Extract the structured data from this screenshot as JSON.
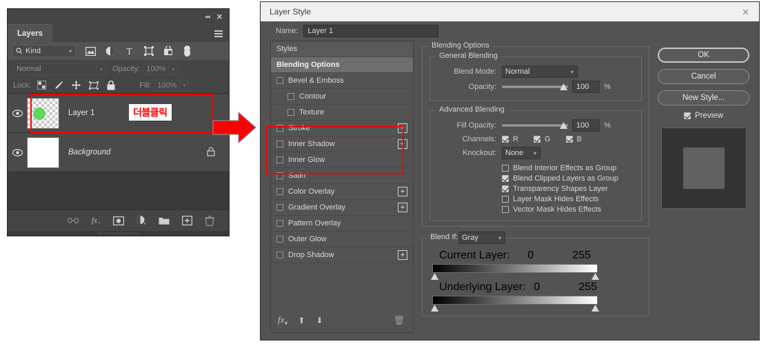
{
  "layers_panel": {
    "title": "Layers",
    "collapse_icon": "double-chevron-left-icon",
    "close_icon": "close-icon",
    "menu_icon": "panel-menu-icon",
    "filter": {
      "kind_label": "Kind",
      "search_icon": "search-icon",
      "chevron": "⌄",
      "icons": [
        "pixel-layer-filter-icon",
        "adjustment-layer-filter-icon",
        "type-layer-filter-icon",
        "shape-layer-filter-icon",
        "smart-object-filter-icon",
        "filter-toggle-icon"
      ]
    },
    "blend_mode": "Normal",
    "opacity_label": "Opacity:",
    "opacity_value": "100%",
    "lock_label": "Lock:",
    "lock_icons": [
      "lock-transparent-pixels-icon",
      "lock-image-pixels-icon",
      "lock-position-icon",
      "lock-artboard-nesting-icon",
      "lock-all-icon"
    ],
    "fill_label": "Fill:",
    "fill_value": "100%",
    "layers": [
      {
        "name": "Layer 1",
        "visible": true,
        "italic": false,
        "locked": false,
        "thumb": "transparent-green-dot",
        "annotation": "더블클릭"
      },
      {
        "name": "Background",
        "visible": true,
        "italic": true,
        "locked": true,
        "thumb": "white",
        "annotation": ""
      }
    ],
    "bottom_icons": [
      "link-layers-icon",
      "add-layer-style-icon",
      "add-layer-mask-icon",
      "new-adjustment-layer-icon",
      "new-group-icon",
      "new-layer-icon",
      "delete-layer-icon"
    ],
    "highlight_color": "#fb0000"
  },
  "arrow": {
    "name": "red-right-arrow",
    "color": "#fb0000"
  },
  "dialog": {
    "title": "Layer Style",
    "close_icon": "close-icon",
    "name_label": "Name:",
    "name_value": "Layer 1",
    "styles": [
      {
        "label": "Styles",
        "type": "header",
        "checkbox": false,
        "plus": false,
        "indent": false,
        "selected": false
      },
      {
        "label": "Blending Options",
        "type": "header",
        "checkbox": false,
        "plus": false,
        "indent": false,
        "selected": true
      },
      {
        "label": "Bevel & Emboss",
        "type": "effect",
        "checkbox": true,
        "checked": false,
        "plus": false,
        "indent": false,
        "selected": false
      },
      {
        "label": "Contour",
        "type": "effect",
        "checkbox": true,
        "checked": false,
        "plus": false,
        "indent": true,
        "selected": false
      },
      {
        "label": "Texture",
        "type": "effect",
        "checkbox": true,
        "checked": false,
        "plus": false,
        "indent": true,
        "selected": false
      },
      {
        "label": "Stroke",
        "type": "effect",
        "checkbox": true,
        "checked": false,
        "plus": true,
        "indent": false,
        "selected": false
      },
      {
        "label": "Inner Shadow",
        "type": "effect",
        "checkbox": true,
        "checked": false,
        "plus": true,
        "indent": false,
        "selected": false
      },
      {
        "label": "Inner Glow",
        "type": "effect",
        "checkbox": true,
        "checked": false,
        "plus": false,
        "indent": false,
        "selected": false
      },
      {
        "label": "Satin",
        "type": "effect",
        "checkbox": true,
        "checked": false,
        "plus": false,
        "indent": false,
        "selected": false
      },
      {
        "label": "Color Overlay",
        "type": "effect",
        "checkbox": true,
        "checked": false,
        "plus": true,
        "indent": false,
        "selected": false
      },
      {
        "label": "Gradient Overlay",
        "type": "effect",
        "checkbox": true,
        "checked": false,
        "plus": true,
        "indent": false,
        "selected": false
      },
      {
        "label": "Pattern Overlay",
        "type": "effect",
        "checkbox": true,
        "checked": false,
        "plus": false,
        "indent": false,
        "selected": false
      },
      {
        "label": "Outer Glow",
        "type": "effect",
        "checkbox": true,
        "checked": false,
        "plus": false,
        "indent": false,
        "selected": false
      },
      {
        "label": "Drop Shadow",
        "type": "effect",
        "checkbox": true,
        "checked": false,
        "plus": true,
        "indent": false,
        "selected": false
      }
    ],
    "styles_footer_icons": [
      "fx-icon",
      "move-up-icon",
      "move-down-icon",
      "delete-icon"
    ],
    "blending_options_legend": "Blending Options",
    "general_blending_legend": "General Blending",
    "blend_mode_label": "Blend Mode:",
    "blend_mode_value": "Normal",
    "opacity_label": "Opacity:",
    "opacity_value": "100",
    "opacity_unit": "%",
    "advanced_blending_legend": "Advanced Blending",
    "fill_opacity_label": "Fill Opacity:",
    "fill_opacity_value": "100",
    "fill_opacity_unit": "%",
    "channels_label": "Channels:",
    "channels": [
      {
        "label": "R",
        "checked": true
      },
      {
        "label": "G",
        "checked": true
      },
      {
        "label": "B",
        "checked": true
      }
    ],
    "knockout_label": "Knockout:",
    "knockout_value": "None",
    "adv_checkboxes": [
      {
        "label": "Blend Interior Effects as Group",
        "checked": false
      },
      {
        "label": "Blend Clipped Layers as Group",
        "checked": true
      },
      {
        "label": "Transparency Shapes Layer",
        "checked": true
      },
      {
        "label": "Layer Mask Hides Effects",
        "checked": false
      },
      {
        "label": "Vector Mask Hides Effects",
        "checked": false
      }
    ],
    "blend_if_label": "Blend If:",
    "blend_if_value": "Gray",
    "current_layer_label": "Current Layer:",
    "current_layer_min": "0",
    "current_layer_max": "255",
    "underlying_layer_label": "Underlying Layer:",
    "underlying_layer_min": "0",
    "underlying_layer_max": "255",
    "buttons": {
      "ok": "OK",
      "cancel": "Cancel",
      "new_style": "New Style...",
      "preview_label": "Preview",
      "preview_checked": true
    }
  }
}
